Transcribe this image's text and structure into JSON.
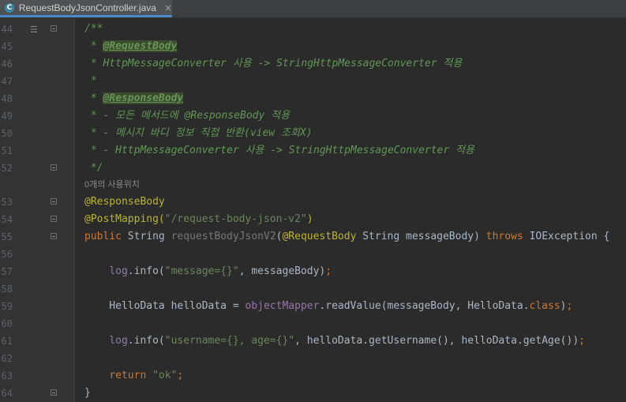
{
  "tab": {
    "icon_letter": "C",
    "filename": "RequestBodyJsonController.java",
    "close": "×"
  },
  "lines": {
    "l44": {
      "num": "44",
      "t1": "/**"
    },
    "l45": {
      "num": "45",
      "t1": " * ",
      "t2": "@RequestBody"
    },
    "l46": {
      "num": "46",
      "t1": " * HttpMessageConverter 사용 -> StringHttpMessageConverter 적용"
    },
    "l47": {
      "num": "47",
      "t1": " *"
    },
    "l48": {
      "num": "48",
      "t1": " * ",
      "t2": "@ResponseBody"
    },
    "l49": {
      "num": "49",
      "t1": " * - 모든 메서드에 @ResponseBody 적용"
    },
    "l50": {
      "num": "50",
      "t1": " * - 메시지 바디 정보 직접 반환(view 조회X)"
    },
    "l51": {
      "num": "51",
      "t1": " * - HttpMessageConverter 사용 -> StringHttpMessageConverter 적용"
    },
    "l52": {
      "num": "52",
      "t1": " */"
    },
    "hint": "0개의 사용위치",
    "l53": {
      "num": "53",
      "t1": "@ResponseBody"
    },
    "l54": {
      "num": "54",
      "t1": "@PostMapping(",
      "t2": "\"/request-body-json-v2\"",
      "t3": ")"
    },
    "l55": {
      "num": "55",
      "t1": "public ",
      "t2": "String ",
      "t3": "requestBodyJsonV2",
      "t4": "(",
      "t5": "@RequestBody ",
      "t6": "String messageBody) ",
      "t7": "throws ",
      "t8": "IOException {"
    },
    "l56": {
      "num": "56"
    },
    "l57": {
      "num": "57",
      "t1": "    ",
      "t2": "log",
      "t3": ".info(",
      "t4": "\"message={}\"",
      "t5": ", messageBody)",
      "t6": ";"
    },
    "l58": {
      "num": "58"
    },
    "l59": {
      "num": "59",
      "t1": "    HelloData helloData = ",
      "t2": "objectMapper",
      "t3": ".readValue(messageBody, HelloData.",
      "t4": "class",
      "t5": ")",
      "t6": ";"
    },
    "l60": {
      "num": "60"
    },
    "l61": {
      "num": "61",
      "t1": "    ",
      "t2": "log",
      "t3": ".info(",
      "t4": "\"username={}, age={}\"",
      "t5": ", helloData.getUsername(), helloData.getAge())",
      "t6": ";"
    },
    "l62": {
      "num": "62"
    },
    "l63": {
      "num": "63",
      "t1": "    ",
      "t2": "return ",
      "t3": "\"ok\"",
      "t4": ";"
    },
    "l64": {
      "num": "64",
      "t1": "}"
    }
  }
}
